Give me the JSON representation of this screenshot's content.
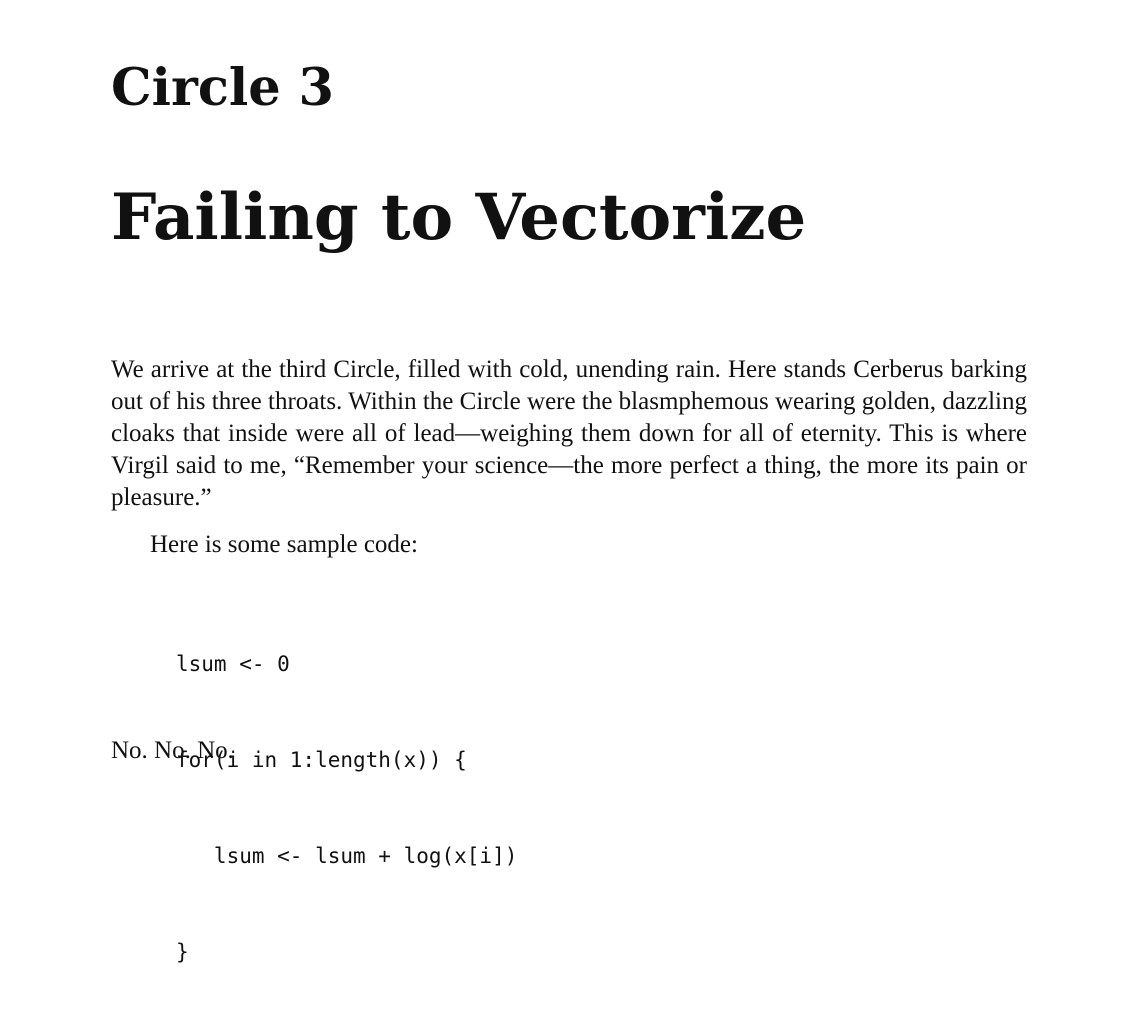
{
  "chapter": {
    "label": "Circle 3",
    "title": "Failing to Vectorize"
  },
  "body": {
    "paragraph": "We arrive at the third Circle, filled with cold, unending rain.  Here stands Cerberus barking out of his three throats.  Within the Circle were the blas­mphemous wearing golden, dazzling cloaks that inside were all of lead—weighing them down for all of eternity. This is where Virgil said to me, “Remember your science—the more perfect a thing, the more its pain or pleasure.”",
    "code_intro": "Here is some sample code:",
    "code_lines": [
      "lsum <- 0",
      "for(i in 1:length(x)) {",
      "   lsum <- lsum + log(x[i])",
      "}"
    ],
    "trailing": "No. No. No."
  }
}
